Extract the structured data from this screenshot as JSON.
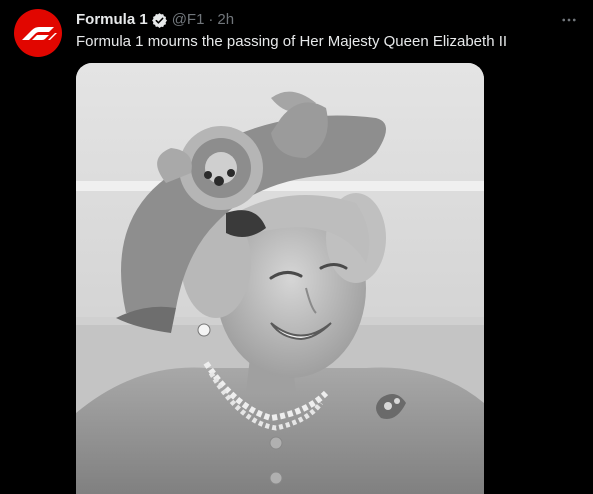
{
  "tweet": {
    "author_name": "Formula 1",
    "handle": "@F1",
    "separator": "·",
    "time": "2h",
    "text": "Formula 1 mourns the passing of Her Majesty Queen Elizabeth II",
    "avatar_icon": "f1-logo-icon",
    "verified_icon": "verified-badge-icon",
    "more_icon": "more-options-icon",
    "media_alt": "Black and white photo of Queen Elizabeth II smiling, wearing a hat with a large flower and a pearl necklace"
  },
  "colors": {
    "background": "#000000",
    "text_primary": "#e7e9ea",
    "text_secondary": "#71767b",
    "brand_red": "#e10600"
  }
}
